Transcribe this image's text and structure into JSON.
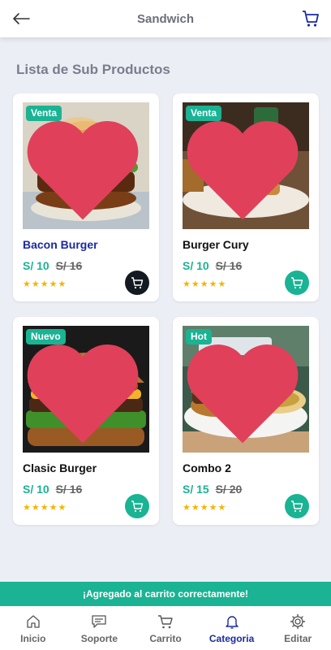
{
  "header": {
    "title": "Sandwich",
    "back_icon": "arrow-left-icon",
    "cart_icon": "shopping-cart-icon"
  },
  "section": {
    "title": "Lista de Sub Productos"
  },
  "products": [
    {
      "badge": "Venta",
      "name": "Bacon Burger",
      "price": "S/ 10",
      "old_price": "S/ 16",
      "rating": 5,
      "stars": "★★★★★"
    },
    {
      "badge": "Venta",
      "name": "Burger Cury",
      "price": "S/ 10",
      "old_price": "S/ 16",
      "rating": 5,
      "stars": "★★★★★"
    },
    {
      "badge": "Nuevo",
      "name": "Clasic Burger",
      "price": "S/ 10",
      "old_price": "S/ 16",
      "rating": 5,
      "stars": "★★★★★"
    },
    {
      "badge": "Hot",
      "name": "Combo 2",
      "price": "S/ 15",
      "old_price": "S/ 20",
      "rating": 5,
      "stars": "★★★★★"
    }
  ],
  "toast": {
    "message": "¡Agregado al carrito correctamente!"
  },
  "tabs": [
    {
      "label": "Inicio",
      "icon": "home-icon"
    },
    {
      "label": "Soporte",
      "icon": "support-icon"
    },
    {
      "label": "Carrito",
      "icon": "cart-icon"
    },
    {
      "label": "Categoria",
      "icon": "bell-icon"
    },
    {
      "label": "Editar",
      "icon": "gear-icon"
    }
  ],
  "colors": {
    "accent": "#1ab394",
    "active": "#1b2aa0",
    "heart": "#e0405a",
    "star": "#f4b400"
  }
}
